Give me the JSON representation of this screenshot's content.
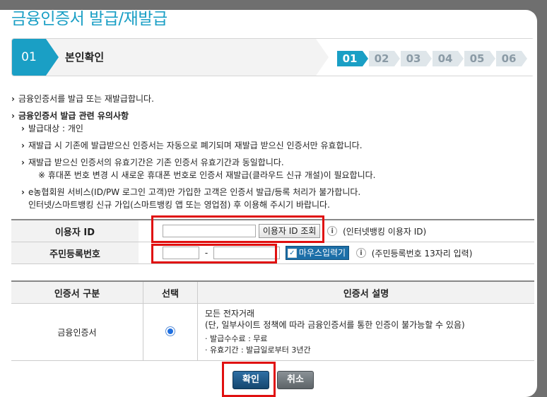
{
  "page": {
    "title": "금융인증서 발급/재발급"
  },
  "steps": {
    "current_num": "01",
    "current_label": "본인확인",
    "items": [
      "01",
      "02",
      "03",
      "04",
      "05",
      "06"
    ],
    "active_index": 0
  },
  "notes": {
    "intro": "금융인증서를 발급 또는 재발급합니다.",
    "heading": "금융인증서 발급 관련 유의사항",
    "items": [
      "발급대상 : 개인",
      "재발급 시 기존에 발급받으신 인증서는 자동으로 폐기되며 재발급 받으신 인증서만 유효합니다.",
      "재발급 받으신 인증서의 유효기간은 기존 인증서 유효기간과 동일합니다.",
      "※ 휴대폰 번호 변경 시 새로운 휴대폰 번호로 인증서 재발급(클라우드 신규 개설)이 필요합니다.",
      "e농협회원 서비스(ID/PW 로그인 고객)만 가입한 고객은 인증서 발급/등록 처리가 불가합니다.",
      "인터넷/스마트뱅킹 신규 가입(스마트뱅킹 앱 또는 영업점) 후 이용해 주시기 바랍니다."
    ]
  },
  "form": {
    "user_id_label": "이용자 ID",
    "user_id_value": "",
    "user_id_lookup_button": "이용자 ID 조회",
    "user_id_hint": "(인터넷뱅킹 이용자 ID)",
    "rrn_label": "주민등록번호",
    "rrn_separator": "-",
    "mouse_input_label": "마우스입력기",
    "mouse_input_checked": true,
    "rrn_hint": "(주민등록번호 13자리 입력)",
    "info_icon_glyph": "i"
  },
  "cert_table": {
    "headers": [
      "인증서 구분",
      "선택",
      "인증서 설명"
    ],
    "row": {
      "type": "금융인증서",
      "selected": true,
      "desc_title": "모든 전자거래",
      "desc_note": "(단, 일부사이트 정책에 따라 금융인증서를 통한 인증이 불가능할 수 있음)",
      "desc_fee": "· 발급수수료 : 무료",
      "desc_validity": "· 유효기간 : 발급일로부터 3년간"
    }
  },
  "buttons": {
    "confirm": "확인",
    "cancel": "취소"
  },
  "colors": {
    "accent": "#1a9fc5",
    "highlight_box": "#e01010",
    "confirm_btn": "#1f5a8a",
    "cancel_btn": "#6f767a"
  }
}
